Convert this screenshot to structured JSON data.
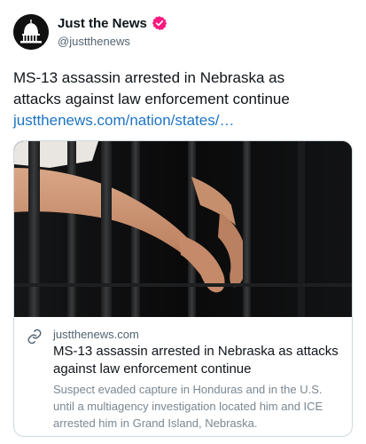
{
  "account": {
    "display_name": "Just the News",
    "handle": "@justthenews",
    "avatar_icon": "capitol-dome-icon",
    "verified_icon": "verified-badge-icon",
    "verified_color": "#f91880"
  },
  "post": {
    "text_line_1": "MS-13 assassin arrested in Nebraska as",
    "text_line_2": "attacks against law enforcement continue",
    "link_text": "justthenews.com/nation/states/…",
    "link_color": "#1d74c4"
  },
  "card": {
    "image_icon": "hands-through-jail-bars-image",
    "link_icon": "link-icon",
    "domain": "justthenews.com",
    "title": "MS-13 assassin arrested in Nebraska as attacks against law enforcement continue",
    "description": "Suspect evaded capture in Honduras and in the U.S. until a multiagency investigation located him and ICE arrested him in Grand Island, Nebraska."
  }
}
